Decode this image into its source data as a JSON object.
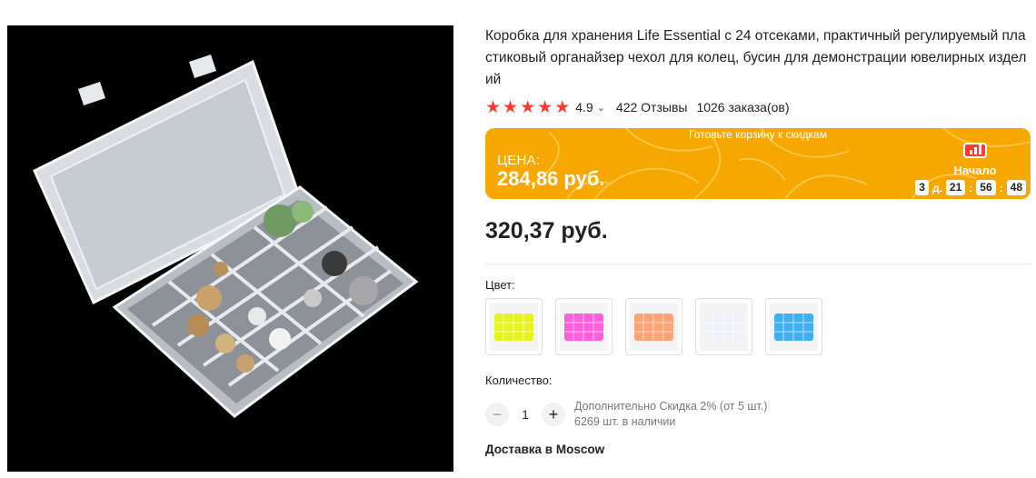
{
  "product": {
    "title": "Коробка для хранения Life Essential с 24 отсеками, практичный регулируемый пластиковый органайзер чехол для колец, бусин для демонстрации ювелирных изделий",
    "image_icon": "jewelry-organizer-box-photo"
  },
  "rating": {
    "stars": 5,
    "value": "4.9",
    "reviews": "422 Отзывы",
    "orders": "1026 заказа(ов)"
  },
  "promo": {
    "top_text": "Готовьте корзину к скидкам",
    "price_label": "ЦЕНА:",
    "price": "284,86 руб.",
    "start_label": "Начало",
    "timer": {
      "days": "3",
      "days_unit": "д.",
      "hours": "21",
      "minutes": "56",
      "seconds": "48"
    },
    "color": "#f7a800"
  },
  "price": "320,37 руб.",
  "color_section": {
    "label": "Цвет:",
    "options": [
      {
        "name": "yellow",
        "color": "#e6f20a"
      },
      {
        "name": "pink",
        "color": "#ff4fd8"
      },
      {
        "name": "orange",
        "color": "#ff9a6a"
      },
      {
        "name": "white",
        "color": "#eef2f7"
      },
      {
        "name": "blue",
        "color": "#2ea8f0"
      }
    ]
  },
  "quantity": {
    "label": "Количество:",
    "minus": "−",
    "value": "1",
    "plus": "+",
    "discount": "Дополнительно Скидка 2% (от 5 шт.)",
    "stock": "6269 шт. в наличии"
  },
  "delivery": "Доставка в Moscow"
}
